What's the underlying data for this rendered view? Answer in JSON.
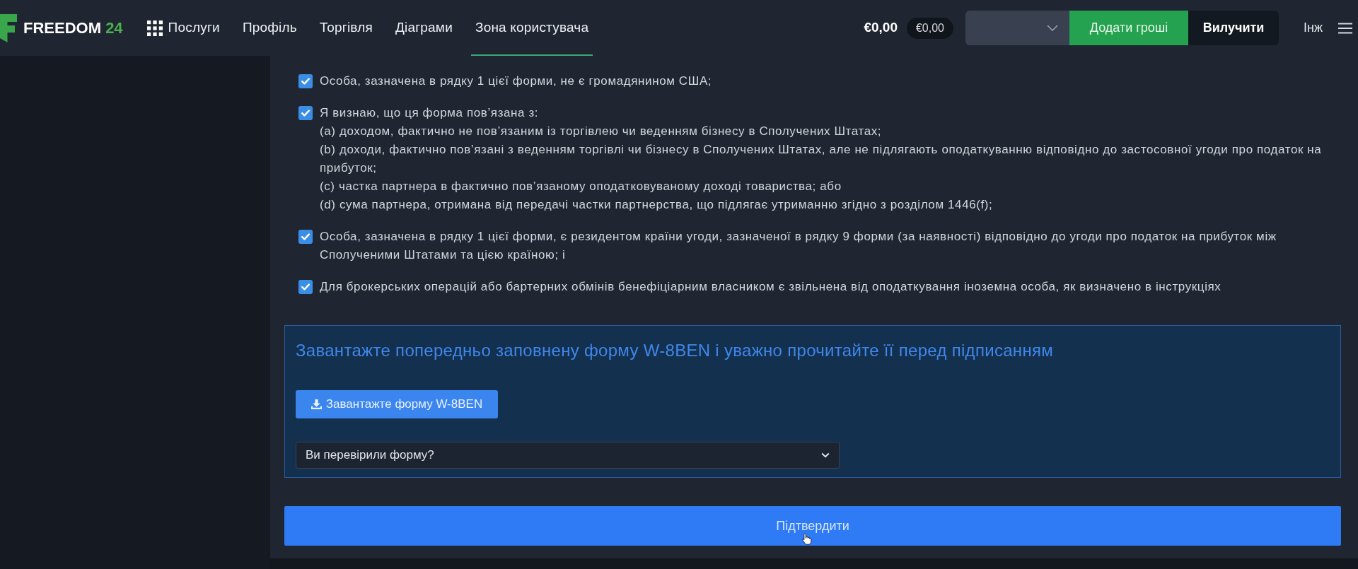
{
  "header": {
    "logo": {
      "name": "FREEDOM",
      "number": "24"
    },
    "nav": [
      {
        "kind": "grid-menu",
        "label": "Послуги",
        "selected": false
      },
      {
        "kind": "link",
        "label": "Профіль",
        "selected": false
      },
      {
        "kind": "link",
        "label": "Торгівля",
        "selected": false
      },
      {
        "kind": "link",
        "label": "Діаграми",
        "selected": false
      },
      {
        "kind": "link",
        "label": "Зона користувача",
        "selected": true
      }
    ],
    "balance": "€0,00",
    "balance_badge": "€0,00",
    "buttons": [
      {
        "kind": "deposit",
        "label": "Додати гроші"
      },
      {
        "kind": "withdraw",
        "label": "Вилучити"
      }
    ],
    "language": "Інж"
  },
  "statements": [
    {
      "checked": true,
      "text": "Особа, зазначена в рядку 1 цієї форми, не є громадянином США;"
    },
    {
      "checked": true,
      "text": "Я визнаю, що ця форма пов’язана з:",
      "sub_items": [
        "(a) доходом, фактично не пов’язаним із торгівлею чи веденням бізнесу в Сполучених Штатах;",
        "(b) доходи, фактично пов’язані з веденням торгівлі чи бізнесу в Сполучених Штатах, але не підлягають оподаткуванню відповідно до застосовної угоди про податок на прибуток;",
        "(c) частка партнера в фактично пов’язаному оподатковуваному доході товариства; або",
        "(d) сума партнера, отримана від передачі частки партнерства, що підлягає утриманню згідно з розділом 1446(f);"
      ]
    },
    {
      "checked": true,
      "text": "Особа, зазначена в рядку 1 цієї форми, є резидентом країни угоди, зазначеної в рядку 9 форми (за наявності) відповідно до угоди про податок на прибуток між Сполученими Штатами та цією країною; і"
    },
    {
      "checked": true,
      "text": "Для брокерських операцій або бартерних обмінів бенефіціарним власником є звільнена від оподаткування іноземна особа, як визначено в інструкціях"
    }
  ],
  "form_box": {
    "title": "Завантажте попередньо заповнену форму W-8BEN і уважно прочитайте її перед підписанням",
    "download_button": "Завантажте форму W-8BEN",
    "select": {
      "value": "Ви перевірили форму?"
    }
  },
  "confirm_button": "Підтвердити"
}
